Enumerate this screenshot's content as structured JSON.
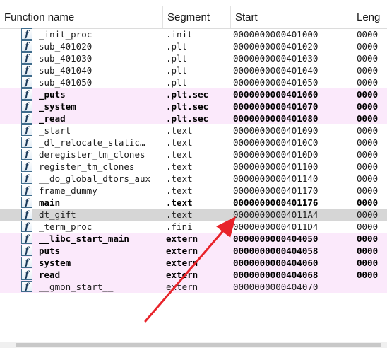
{
  "columns": {
    "name": "Function name",
    "segment": "Segment",
    "start": "Start",
    "length": "Leng"
  },
  "icon_glyph": "f",
  "colors": {
    "library_row": "#fbe9fb",
    "selected_row": "#d6d6d6",
    "arrow": "#e8232a"
  },
  "rows": [
    {
      "name": "_init_proc",
      "segment": ".init",
      "start": "0000000000401000",
      "length": "0000",
      "kind": "normal"
    },
    {
      "name": "sub_401020",
      "segment": ".plt",
      "start": "0000000000401020",
      "length": "0000",
      "kind": "normal"
    },
    {
      "name": "sub_401030",
      "segment": ".plt",
      "start": "0000000000401030",
      "length": "0000",
      "kind": "normal"
    },
    {
      "name": "sub_401040",
      "segment": ".plt",
      "start": "0000000000401040",
      "length": "0000",
      "kind": "normal"
    },
    {
      "name": "sub_401050",
      "segment": ".plt",
      "start": "0000000000401050",
      "length": "0000",
      "kind": "normal"
    },
    {
      "name": "_puts",
      "segment": ".plt.sec",
      "start": "0000000000401060",
      "length": "0000",
      "kind": "lib"
    },
    {
      "name": "_system",
      "segment": ".plt.sec",
      "start": "0000000000401070",
      "length": "0000",
      "kind": "lib"
    },
    {
      "name": "_read",
      "segment": ".plt.sec",
      "start": "0000000000401080",
      "length": "0000",
      "kind": "lib"
    },
    {
      "name": "_start",
      "segment": ".text",
      "start": "0000000000401090",
      "length": "0000",
      "kind": "normal"
    },
    {
      "name": "_dl_relocate_static…",
      "segment": ".text",
      "start": "00000000004010C0",
      "length": "0000",
      "kind": "normal"
    },
    {
      "name": "deregister_tm_clones",
      "segment": ".text",
      "start": "00000000004010D0",
      "length": "0000",
      "kind": "normal"
    },
    {
      "name": "register_tm_clones",
      "segment": ".text",
      "start": "0000000000401100",
      "length": "0000",
      "kind": "normal"
    },
    {
      "name": "__do_global_dtors_aux",
      "segment": ".text",
      "start": "0000000000401140",
      "length": "0000",
      "kind": "normal"
    },
    {
      "name": "frame_dummy",
      "segment": ".text",
      "start": "0000000000401170",
      "length": "0000",
      "kind": "normal"
    },
    {
      "name": "main",
      "segment": ".text",
      "start": "0000000000401176",
      "length": "0000",
      "kind": "bold"
    },
    {
      "name": "dt_gift",
      "segment": ".text",
      "start": "00000000004011A4",
      "length": "0000",
      "kind": "sel"
    },
    {
      "name": "_term_proc",
      "segment": ".fini",
      "start": "00000000004011D4",
      "length": "0000",
      "kind": "normal"
    },
    {
      "name": "__libc_start_main",
      "segment": "extern",
      "start": "0000000000404050",
      "length": "0000",
      "kind": "lib"
    },
    {
      "name": "puts",
      "segment": "extern",
      "start": "0000000000404058",
      "length": "0000",
      "kind": "lib"
    },
    {
      "name": "system",
      "segment": "extern",
      "start": "0000000000404060",
      "length": "0000",
      "kind": "lib"
    },
    {
      "name": "read",
      "segment": "extern",
      "start": "0000000000404068",
      "length": "0000",
      "kind": "lib"
    },
    {
      "name": "__gmon_start__",
      "segment": "extern",
      "start": "0000000000404070",
      "length": "",
      "kind": "libplain"
    }
  ]
}
